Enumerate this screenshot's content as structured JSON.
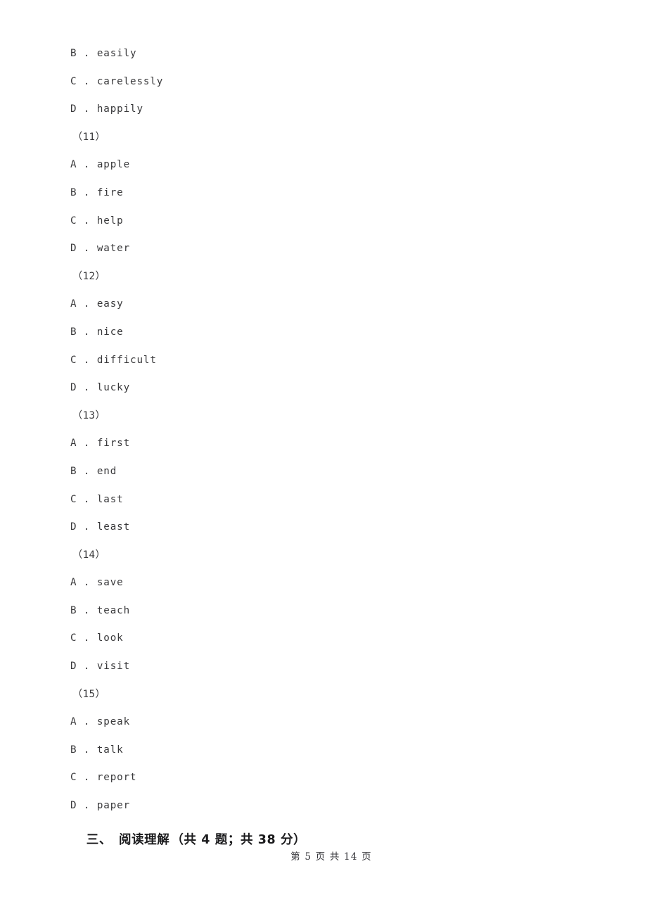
{
  "document": {
    "page_label": "第 5 页 共 14 页",
    "footer": {
      "prefix": "第",
      "current_page": "5",
      "page_unit_1": "页",
      "total_word": "共",
      "total_pages": "14",
      "page_unit_2": "页",
      "full_text": "第 5 页 共 14 页"
    },
    "text_color": "#38383a",
    "background_color": "#ffffff"
  },
  "body_lines": [
    {
      "kind": "option",
      "letter": "B",
      "dot": ".",
      "text": "easily",
      "full": "B . easily"
    },
    {
      "kind": "option",
      "letter": "C",
      "dot": ".",
      "text": "carelessly",
      "full": "C . carelessly"
    },
    {
      "kind": "option",
      "letter": "D",
      "dot": ".",
      "text": "happily",
      "full": "D . happily"
    },
    {
      "kind": "qnum",
      "text": "（11）",
      "full": "（11）"
    },
    {
      "kind": "option",
      "letter": "A",
      "dot": ".",
      "text": "apple",
      "full": "A . apple"
    },
    {
      "kind": "option",
      "letter": "B",
      "dot": ".",
      "text": "fire",
      "full": "B . fire"
    },
    {
      "kind": "option",
      "letter": "C",
      "dot": ".",
      "text": "help",
      "full": "C . help"
    },
    {
      "kind": "option",
      "letter": "D",
      "dot": ".",
      "text": "water",
      "full": "D . water"
    },
    {
      "kind": "qnum",
      "text": "（12）",
      "full": "（12）"
    },
    {
      "kind": "option",
      "letter": "A",
      "dot": ".",
      "text": "easy",
      "full": "A . easy"
    },
    {
      "kind": "option",
      "letter": "B",
      "dot": ".",
      "text": "nice",
      "full": "B . nice"
    },
    {
      "kind": "option",
      "letter": "C",
      "dot": ".",
      "text": "difficult",
      "full": "C . difficult"
    },
    {
      "kind": "option",
      "letter": "D",
      "dot": ".",
      "text": "lucky",
      "full": "D . lucky"
    },
    {
      "kind": "qnum",
      "text": "（13）",
      "full": "（13）"
    },
    {
      "kind": "option",
      "letter": "A",
      "dot": ".",
      "text": "first",
      "full": "A . first"
    },
    {
      "kind": "option",
      "letter": "B",
      "dot": ".",
      "text": "end",
      "full": "B . end"
    },
    {
      "kind": "option",
      "letter": "C",
      "dot": ".",
      "text": "last",
      "full": "C . last"
    },
    {
      "kind": "option",
      "letter": "D",
      "dot": ".",
      "text": "least",
      "full": "D . least"
    },
    {
      "kind": "qnum",
      "text": "（14）",
      "full": "（14）"
    },
    {
      "kind": "option",
      "letter": "A",
      "dot": ".",
      "text": "save",
      "full": "A . save"
    },
    {
      "kind": "option",
      "letter": "B",
      "dot": ".",
      "text": "teach",
      "full": "B . teach"
    },
    {
      "kind": "option",
      "letter": "C",
      "dot": ".",
      "text": "look",
      "full": "C . look"
    },
    {
      "kind": "option",
      "letter": "D",
      "dot": ".",
      "text": "visit",
      "full": "D . visit"
    },
    {
      "kind": "qnum",
      "text": "（15）",
      "full": "（15）"
    },
    {
      "kind": "option",
      "letter": "A",
      "dot": ".",
      "text": "speak",
      "full": "A . speak"
    },
    {
      "kind": "option",
      "letter": "B",
      "dot": ".",
      "text": "talk",
      "full": "B . talk"
    },
    {
      "kind": "option",
      "letter": "C",
      "dot": ".",
      "text": "report",
      "full": "C . report"
    },
    {
      "kind": "option",
      "letter": "D",
      "dot": ".",
      "text": "paper",
      "full": "D . paper"
    }
  ],
  "section_heading": {
    "number": "三、",
    "title": "阅读理解",
    "meta": "（共 4 题；共 38 分）",
    "question_count": "4",
    "total_points": "38",
    "full_text": "三、 阅读理解（共 4 题；共 38 分）"
  }
}
